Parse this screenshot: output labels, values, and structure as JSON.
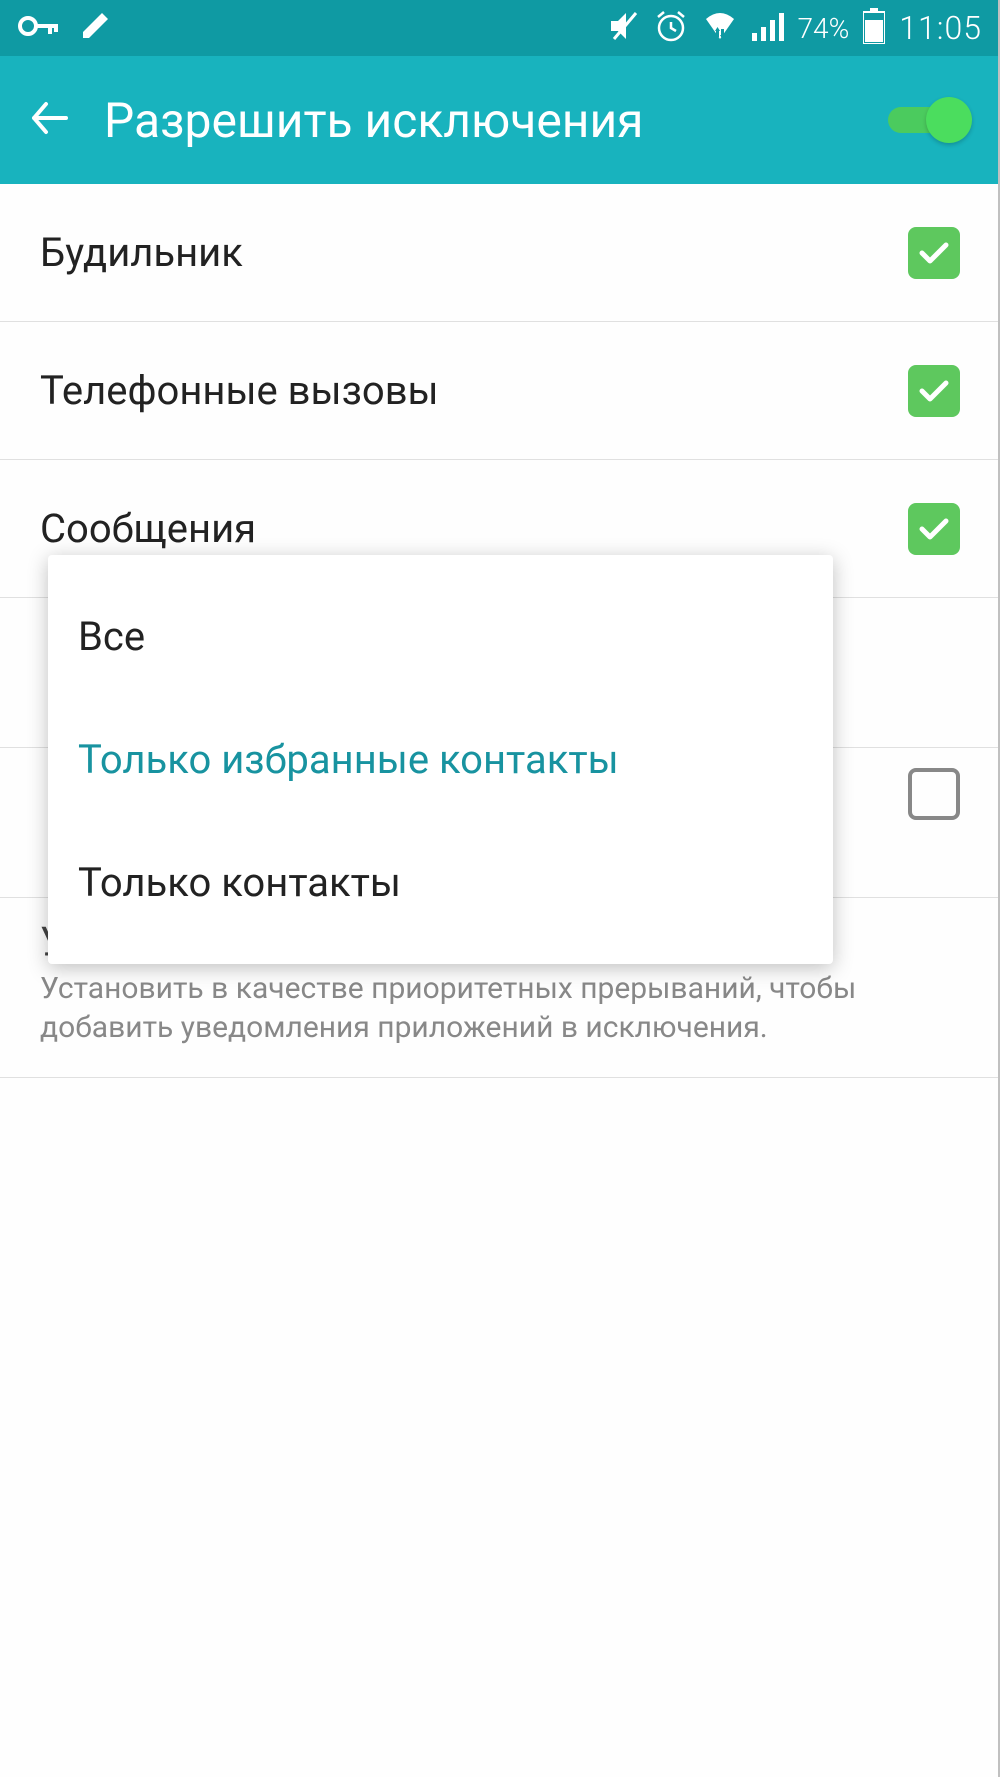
{
  "status_bar": {
    "battery_percent": "74%",
    "time": "11:05"
  },
  "header": {
    "title": "Разрешить исключения",
    "toggle_on": true
  },
  "list": {
    "alarm": {
      "label": "Будильник",
      "checked": true
    },
    "calls": {
      "label": "Телефонные вызовы",
      "checked": true
    },
    "messages": {
      "label": "Сообщения",
      "checked": true
    },
    "hidden_item": {
      "checked": false
    },
    "app_notifications": {
      "label": "Уведомления приложении",
      "description": "Установить в качестве приоритетных прерываний, чтобы добавить уведомления приложений в исключения."
    }
  },
  "popup": {
    "options": [
      {
        "label": "Все",
        "selected": false
      },
      {
        "label": "Только избранные контакты",
        "selected": true
      },
      {
        "label": "Только контакты",
        "selected": false
      }
    ]
  }
}
